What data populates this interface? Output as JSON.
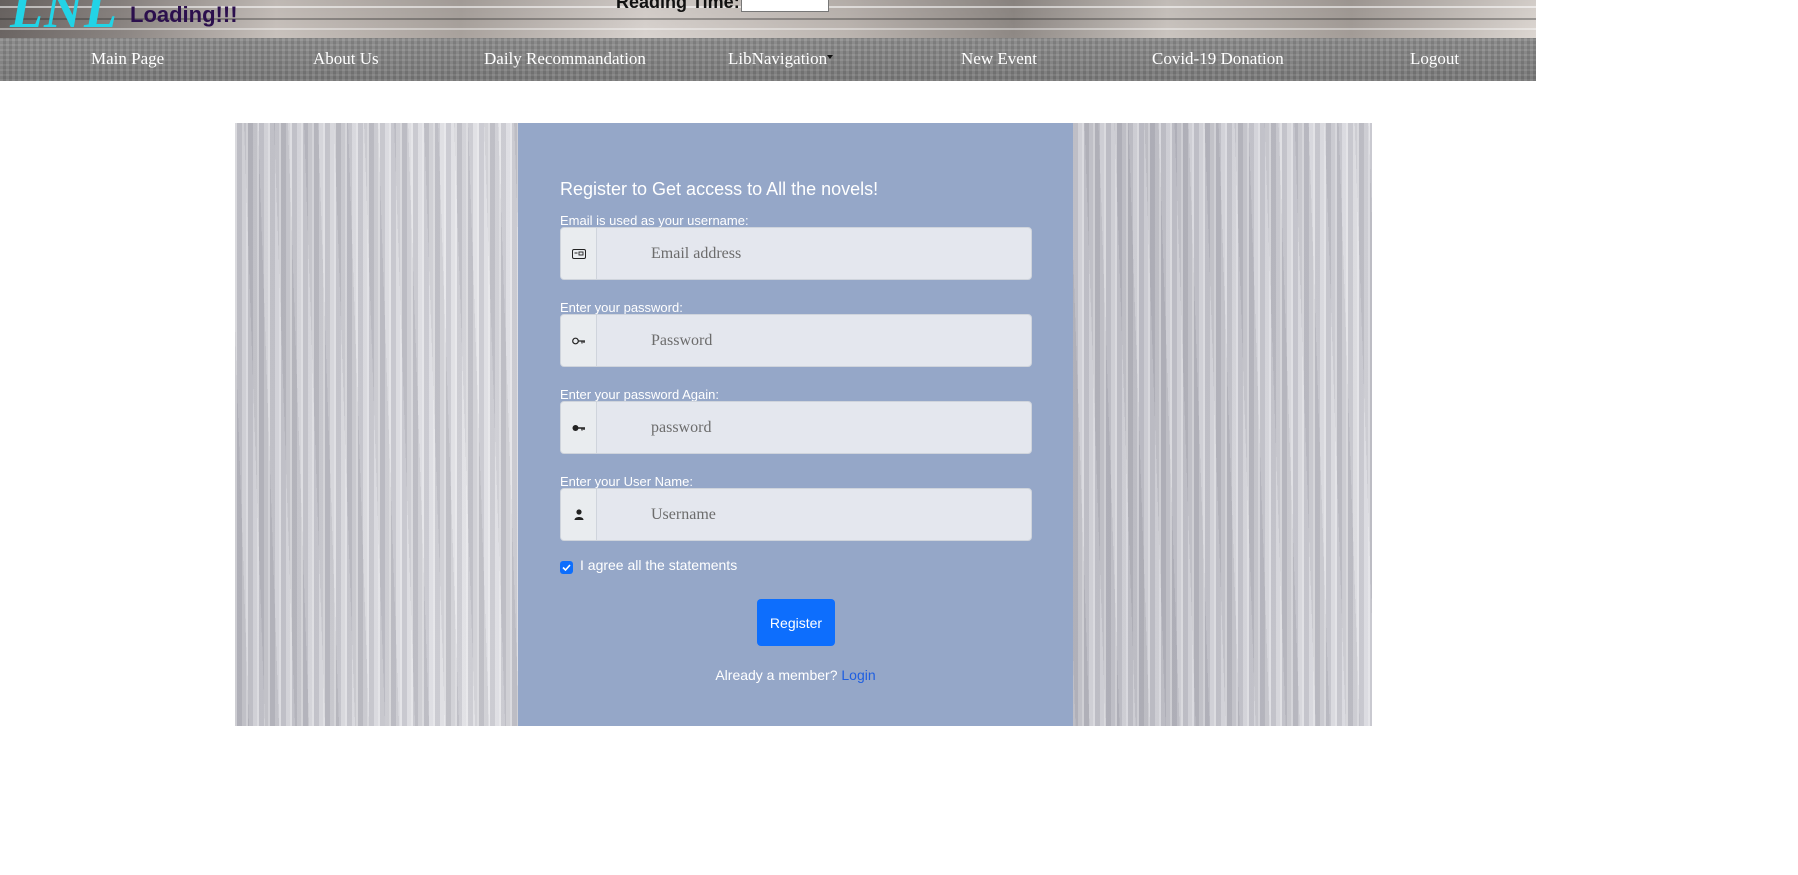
{
  "header": {
    "logo": "LNL",
    "loading": "Loading!!!",
    "reading_time_label": "Reading Time:",
    "reading_time_value": ""
  },
  "nav": {
    "items": [
      {
        "label": "Main Page"
      },
      {
        "label": "About Us"
      },
      {
        "label": "Daily Recommandation"
      },
      {
        "label": "LibNavigation"
      },
      {
        "label": "New Event"
      },
      {
        "label": "Covid-19 Donation"
      },
      {
        "label": "Logout"
      }
    ]
  },
  "form": {
    "title": "Register to Get access to All the novels!",
    "email": {
      "label": "Email is used as your username:",
      "placeholder": "Email address",
      "value": "",
      "icon": "id-card-icon"
    },
    "password": {
      "label": "Enter your password:",
      "placeholder": "Password",
      "value": "",
      "icon": "key-outline-icon"
    },
    "password_again": {
      "label": "Enter your password Again:",
      "placeholder": "password",
      "value": "",
      "icon": "key-icon"
    },
    "username": {
      "label": "Enter your User Name:",
      "placeholder": "Username",
      "value": "",
      "icon": "person-icon"
    },
    "agree": {
      "label": "I agree all the statements",
      "checked": true
    },
    "register_label": "Register",
    "member_text": "Already a member?",
    "login_label": "Login"
  },
  "colors": {
    "form_panel": "#95a7c8",
    "button": "#0d6efd",
    "logo": "#22d3e6",
    "loading": "#2b0f4d",
    "login_link": "#1f5fe0"
  }
}
